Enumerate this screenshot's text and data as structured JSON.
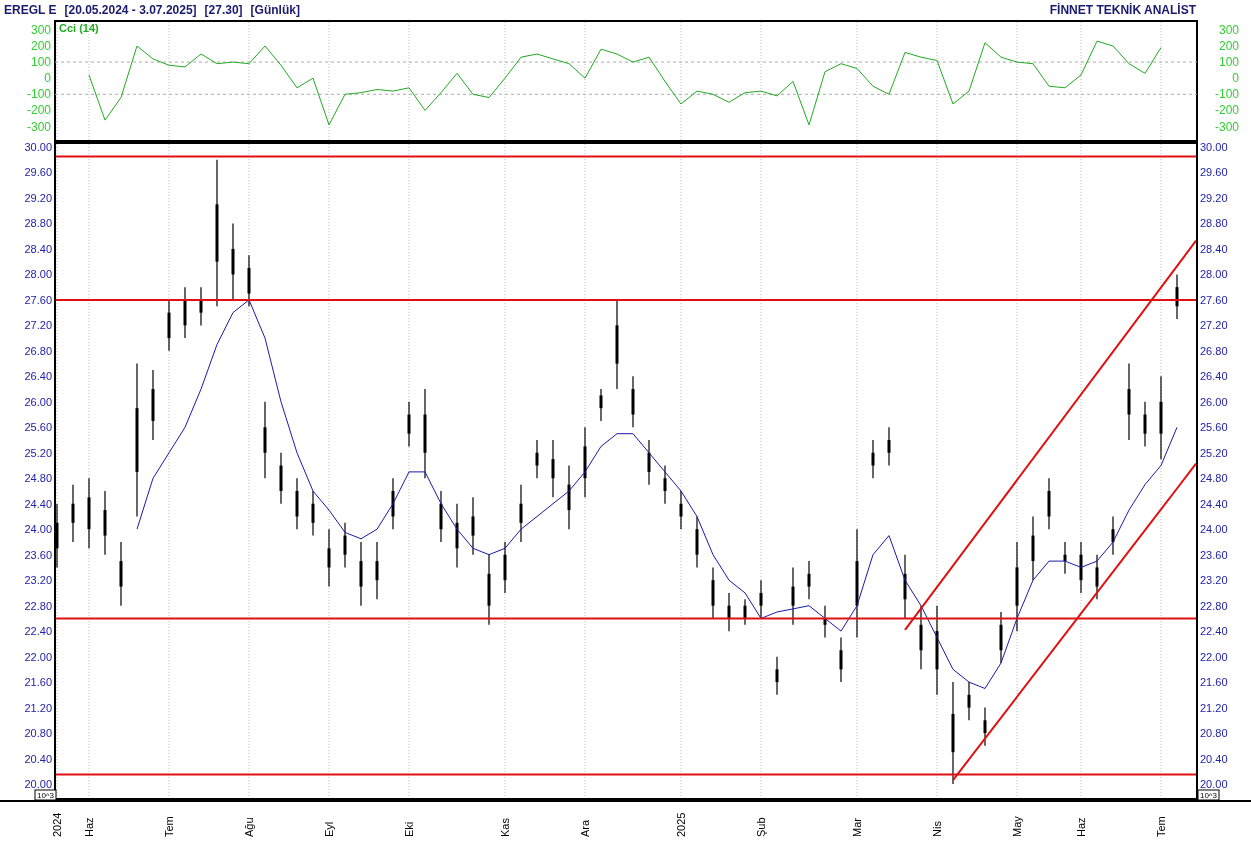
{
  "header": {
    "symbol": "EREGL E",
    "range": "[20.05.2024 - 3.07.2025]",
    "last": "[27.30]",
    "period": "[Günlük]",
    "brand": "FİNNET TEKNİK ANALİST"
  },
  "cci_panel": {
    "right_axis_labels": [
      "300",
      "200",
      "100",
      "0",
      "-100",
      "-200",
      "-300"
    ],
    "chart_data": {
      "type": "line",
      "categories": [
        null,
        null,
        null,
        null,
        null,
        null,
        null,
        null,
        null,
        null,
        null,
        null,
        null,
        null,
        null,
        null,
        null,
        null,
        null,
        null,
        null,
        null,
        null,
        null,
        null,
        null,
        null,
        null,
        null,
        null,
        null,
        null,
        null,
        null,
        null,
        null,
        null,
        null,
        null,
        null,
        null,
        null,
        null,
        null,
        null,
        null,
        null,
        null,
        null,
        null,
        null,
        null,
        null,
        null,
        null,
        null,
        null,
        null,
        null,
        null,
        null,
        null,
        null,
        null,
        null,
        null,
        null,
        null
      ],
      "series": [
        {
          "name": "Cci (14)",
          "color": "#22aa22",
          "values": [
            20,
            -260,
            -120,
            200,
            120,
            80,
            70,
            150,
            90,
            100,
            90,
            200,
            80,
            -60,
            0,
            -290,
            -100,
            -90,
            -70,
            -80,
            -60,
            -200,
            -90,
            30,
            -100,
            -120,
            0,
            130,
            150,
            120,
            90,
            0,
            180,
            150,
            100,
            130,
            -20,
            -160,
            -80,
            -100,
            -150,
            -90,
            -80,
            -110,
            -20,
            -290,
            40,
            90,
            60,
            -50,
            -100,
            160,
            130,
            110,
            -160,
            -80,
            220,
            130,
            100,
            90,
            -50,
            -60,
            20,
            230,
            200,
            90,
            30,
            190
          ]
        }
      ],
      "ylim": [
        -390,
        355
      ],
      "yticks": [
        300,
        200,
        100,
        0,
        -100,
        -200,
        -300
      ],
      "grid": true
    }
  },
  "price_panel": {
    "scale_label_left": "10^3",
    "scale_label_right": "10^3",
    "chart_data": {
      "type": "candlestick",
      "categories": [
        "2024",
        null,
        "Haz",
        null,
        null,
        null,
        null,
        "Tem",
        null,
        null,
        null,
        null,
        "Ağu",
        null,
        null,
        null,
        null,
        "Eyl",
        null,
        null,
        null,
        null,
        "Eki",
        null,
        null,
        null,
        null,
        null,
        "Kas",
        null,
        null,
        null,
        null,
        "Ara",
        null,
        null,
        null,
        null,
        null,
        "2025",
        null,
        null,
        null,
        null,
        "Şub",
        null,
        null,
        null,
        null,
        null,
        "Mar",
        null,
        null,
        null,
        null,
        "Nis",
        null,
        null,
        null,
        null,
        "May",
        null,
        null,
        null,
        "Haz",
        null,
        null,
        null,
        null,
        "Tem",
        null
      ],
      "series": [
        {
          "type": "candlestick",
          "color": "#000000",
          "ohlc": [
            [
              23.7,
              24.4,
              23.4,
              24.1
            ],
            [
              24.1,
              24.7,
              23.8,
              24.4
            ],
            [
              24.0,
              24.8,
              23.7,
              24.5
            ],
            [
              23.9,
              24.6,
              23.6,
              24.3
            ],
            [
              23.1,
              23.8,
              22.8,
              23.5
            ],
            [
              24.9,
              26.6,
              24.2,
              25.9
            ],
            [
              25.7,
              26.5,
              25.4,
              26.2
            ],
            [
              27.0,
              27.6,
              26.8,
              27.4
            ],
            [
              27.2,
              27.8,
              27.0,
              27.6
            ],
            [
              27.4,
              27.8,
              27.2,
              27.6
            ],
            [
              28.2,
              29.8,
              27.5,
              29.1
            ],
            [
              28.0,
              28.8,
              27.6,
              28.4
            ],
            [
              27.7,
              28.3,
              27.5,
              28.1
            ],
            [
              25.2,
              26.0,
              24.8,
              25.6
            ],
            [
              24.6,
              25.2,
              24.4,
              25.0
            ],
            [
              24.2,
              24.8,
              24.0,
              24.6
            ],
            [
              24.1,
              24.6,
              23.9,
              24.4
            ],
            [
              23.4,
              24.0,
              23.1,
              23.7
            ],
            [
              23.6,
              24.1,
              23.4,
              23.9
            ],
            [
              23.1,
              23.8,
              22.8,
              23.5
            ],
            [
              23.2,
              23.8,
              22.9,
              23.5
            ],
            [
              24.2,
              24.8,
              24.0,
              24.6
            ],
            [
              25.5,
              26.0,
              25.3,
              25.8
            ],
            [
              25.2,
              26.2,
              24.8,
              25.8
            ],
            [
              24.0,
              24.6,
              23.8,
              24.4
            ],
            [
              23.7,
              24.4,
              23.4,
              24.1
            ],
            [
              23.9,
              24.5,
              23.6,
              24.2
            ],
            [
              22.8,
              23.6,
              22.5,
              23.3
            ],
            [
              23.2,
              23.8,
              23.0,
              23.6
            ],
            [
              24.1,
              24.7,
              23.8,
              24.4
            ],
            [
              25.0,
              25.4,
              24.8,
              25.2
            ],
            [
              24.8,
              25.4,
              24.5,
              25.1
            ],
            [
              24.3,
              25.0,
              24.0,
              24.7
            ],
            [
              24.8,
              25.6,
              24.5,
              25.3
            ],
            [
              25.9,
              26.2,
              25.7,
              26.1
            ],
            [
              26.6,
              27.6,
              26.2,
              27.2
            ],
            [
              25.8,
              26.4,
              25.6,
              26.2
            ],
            [
              24.9,
              25.4,
              24.7,
              25.2
            ],
            [
              24.6,
              25.0,
              24.4,
              24.8
            ],
            [
              24.2,
              24.6,
              24.0,
              24.4
            ],
            [
              23.6,
              24.2,
              23.4,
              24.0
            ],
            [
              22.8,
              23.4,
              22.6,
              23.2
            ],
            [
              22.6,
              23.0,
              22.4,
              22.8
            ],
            [
              22.6,
              22.9,
              22.5,
              22.8
            ],
            [
              22.8,
              23.2,
              22.6,
              23.0
            ],
            [
              21.6,
              22.0,
              21.4,
              21.8
            ],
            [
              22.8,
              23.4,
              22.5,
              23.1
            ],
            [
              23.1,
              23.5,
              22.9,
              23.3
            ],
            [
              22.5,
              22.8,
              22.3,
              22.6
            ],
            [
              21.8,
              22.3,
              21.6,
              22.1
            ],
            [
              22.8,
              24.0,
              22.3,
              23.5
            ],
            [
              25.0,
              25.4,
              24.8,
              25.2
            ],
            [
              25.2,
              25.6,
              25.0,
              25.4
            ],
            [
              22.9,
              23.6,
              22.6,
              23.3
            ],
            [
              22.1,
              22.8,
              21.8,
              22.5
            ],
            [
              21.8,
              22.8,
              21.4,
              22.4
            ],
            [
              20.5,
              21.6,
              20.0,
              21.1
            ],
            [
              21.2,
              21.6,
              21.0,
              21.4
            ],
            [
              20.8,
              21.2,
              20.6,
              21.0
            ],
            [
              22.1,
              22.7,
              21.9,
              22.5
            ],
            [
              22.8,
              23.8,
              22.4,
              23.4
            ],
            [
              23.5,
              24.2,
              23.2,
              23.9
            ],
            [
              24.2,
              24.8,
              24.0,
              24.6
            ],
            [
              23.5,
              23.8,
              23.3,
              23.6
            ],
            [
              23.2,
              23.8,
              23.0,
              23.6
            ],
            [
              23.1,
              23.6,
              22.9,
              23.4
            ],
            [
              23.8,
              24.2,
              23.6,
              24.0
            ],
            [
              25.8,
              26.6,
              25.4,
              26.2
            ],
            [
              25.5,
              26.0,
              25.3,
              25.8
            ],
            [
              25.5,
              26.4,
              25.1,
              26.0
            ],
            [
              27.5,
              28.0,
              27.3,
              27.8
            ]
          ]
        },
        {
          "type": "line",
          "color": "#1a1aaa",
          "values": [
            null,
            null,
            null,
            null,
            null,
            24.0,
            24.8,
            25.2,
            25.6,
            26.2,
            26.9,
            27.4,
            27.6,
            27.0,
            26.0,
            25.2,
            24.6,
            24.3,
            23.95,
            23.85,
            24.0,
            24.4,
            24.9,
            24.9,
            24.4,
            24.0,
            23.7,
            23.6,
            23.7,
            24.0,
            24.2,
            24.4,
            24.6,
            24.9,
            25.3,
            25.5,
            25.5,
            25.2,
            24.9,
            24.6,
            24.2,
            23.6,
            23.2,
            23.0,
            22.6,
            22.7,
            22.75,
            22.8,
            22.6,
            22.4,
            22.8,
            23.6,
            23.9,
            23.2,
            22.8,
            22.3,
            21.8,
            21.6,
            21.5,
            21.9,
            22.6,
            23.2,
            23.5,
            23.5,
            23.4,
            23.5,
            23.8,
            24.3,
            24.7,
            25.0,
            25.6
          ]
        },
        {
          "type": "line",
          "color": "#e01010",
          "values": [
            29.85,
            null,
            null,
            null,
            null,
            null,
            null,
            null,
            null,
            null,
            null,
            null,
            null,
            null,
            null,
            null,
            null,
            null,
            null,
            null,
            null,
            null,
            null,
            null,
            null,
            null,
            null,
            null,
            null,
            null,
            null,
            null,
            null,
            null,
            null,
            null,
            null,
            null,
            null,
            null,
            null,
            null,
            null,
            null,
            null,
            null,
            null,
            null,
            null,
            null,
            null,
            null,
            null,
            null,
            null,
            null,
            null,
            null,
            null,
            null,
            null,
            null,
            null,
            null,
            null,
            null,
            null,
            null,
            null,
            null,
            29.85
          ]
        },
        {
          "type": "line",
          "color": "#e01010",
          "values": [
            27.6,
            null,
            null,
            null,
            null,
            null,
            null,
            null,
            null,
            null,
            null,
            null,
            null,
            null,
            null,
            null,
            null,
            null,
            null,
            null,
            null,
            null,
            null,
            null,
            null,
            null,
            null,
            null,
            null,
            null,
            null,
            null,
            null,
            null,
            null,
            null,
            null,
            null,
            null,
            null,
            null,
            null,
            null,
            null,
            null,
            null,
            null,
            null,
            null,
            null,
            null,
            null,
            null,
            null,
            null,
            null,
            null,
            null,
            null,
            null,
            null,
            null,
            null,
            null,
            null,
            null,
            null,
            null,
            null,
            null,
            27.6
          ]
        },
        {
          "type": "line",
          "color": "#e01010",
          "values": [
            22.6,
            null,
            null,
            null,
            null,
            null,
            null,
            null,
            null,
            null,
            null,
            null,
            null,
            null,
            null,
            null,
            null,
            null,
            null,
            null,
            null,
            null,
            null,
            null,
            null,
            null,
            null,
            null,
            null,
            null,
            null,
            null,
            null,
            null,
            null,
            null,
            null,
            null,
            null,
            null,
            null,
            null,
            null,
            null,
            null,
            null,
            null,
            null,
            null,
            null,
            null,
            null,
            null,
            null,
            null,
            null,
            null,
            null,
            null,
            null,
            null,
            null,
            null,
            null,
            null,
            null,
            null,
            null,
            null,
            null,
            22.6
          ]
        },
        {
          "type": "line",
          "color": "#e01010",
          "values": [
            20.15,
            null,
            null,
            null,
            null,
            null,
            null,
            null,
            null,
            null,
            null,
            null,
            null,
            null,
            null,
            null,
            null,
            null,
            null,
            null,
            null,
            null,
            null,
            null,
            null,
            null,
            null,
            null,
            null,
            null,
            null,
            null,
            null,
            null,
            null,
            null,
            null,
            null,
            null,
            null,
            null,
            null,
            null,
            null,
            null,
            null,
            null,
            null,
            null,
            null,
            null,
            null,
            null,
            null,
            null,
            null,
            null,
            null,
            null,
            null,
            null,
            null,
            null,
            null,
            null,
            null,
            null,
            null,
            null,
            null,
            20.15
          ]
        },
        {
          "type": "line",
          "color": "#e01010",
          "values": [
            null,
            null,
            null,
            null,
            null,
            null,
            null,
            null,
            null,
            null,
            null,
            null,
            null,
            null,
            null,
            null,
            null,
            null,
            null,
            null,
            null,
            null,
            null,
            null,
            null,
            null,
            null,
            null,
            null,
            null,
            null,
            null,
            null,
            null,
            null,
            null,
            null,
            null,
            null,
            null,
            null,
            null,
            null,
            null,
            null,
            null,
            null,
            null,
            null,
            null,
            null,
            null,
            null,
            22.42,
            null,
            null,
            null,
            null,
            null,
            null,
            null,
            null,
            null,
            null,
            null,
            null,
            null,
            null,
            null,
            null,
            28.13
          ]
        },
        {
          "type": "line",
          "color": "#e01010",
          "values": [
            null,
            null,
            null,
            null,
            null,
            null,
            null,
            null,
            null,
            null,
            null,
            null,
            null,
            null,
            null,
            null,
            null,
            null,
            null,
            null,
            null,
            null,
            null,
            null,
            null,
            null,
            null,
            null,
            null,
            null,
            null,
            null,
            null,
            null,
            null,
            null,
            null,
            null,
            null,
            null,
            null,
            null,
            null,
            null,
            null,
            null,
            null,
            null,
            null,
            null,
            null,
            null,
            null,
            null,
            null,
            null,
            20.06,
            null,
            null,
            null,
            null,
            null,
            null,
            null,
            null,
            null,
            null,
            null,
            null,
            null,
            24.64
          ]
        }
      ],
      "ylim": [
        19.765,
        30.063
      ],
      "yticks": [
        {
          "value": 30,
          "label": "30.00"
        },
        {
          "value": 29.6,
          "label": "29.60"
        },
        {
          "value": 29.2,
          "label": "29.20"
        },
        {
          "value": 28.8,
          "label": "28.80"
        },
        {
          "value": 28.4,
          "label": "28.40"
        },
        {
          "value": 28,
          "label": "28.00"
        },
        {
          "value": 27.6,
          "label": "27.60"
        },
        {
          "value": 27.2,
          "label": "27.20"
        },
        {
          "value": 26.8,
          "label": "26.80"
        },
        {
          "value": 26.4,
          "label": "26.40"
        },
        {
          "value": 26,
          "label": "26.00"
        },
        {
          "value": 25.6,
          "label": "25.60"
        },
        {
          "value": 25.2,
          "label": "25.20"
        },
        {
          "value": 24.8,
          "label": "24.80"
        },
        {
          "value": 24.4,
          "label": "24.40"
        },
        {
          "value": 24,
          "label": "24.00"
        },
        {
          "value": 23.6,
          "label": "23.60"
        },
        {
          "value": 23.2,
          "label": "23.20"
        },
        {
          "value": 22.8,
          "label": "22.80"
        },
        {
          "value": 22.4,
          "label": "22.40"
        },
        {
          "value": 22,
          "label": "22.00"
        },
        {
          "value": 21.6,
          "label": "21.60"
        },
        {
          "value": 21.2,
          "label": "21.20"
        },
        {
          "value": 20.8,
          "label": "20.80"
        },
        {
          "value": 20.4,
          "label": "20.40"
        },
        {
          "value": 20,
          "label": "20.00"
        }
      ],
      "grid": true
    }
  }
}
